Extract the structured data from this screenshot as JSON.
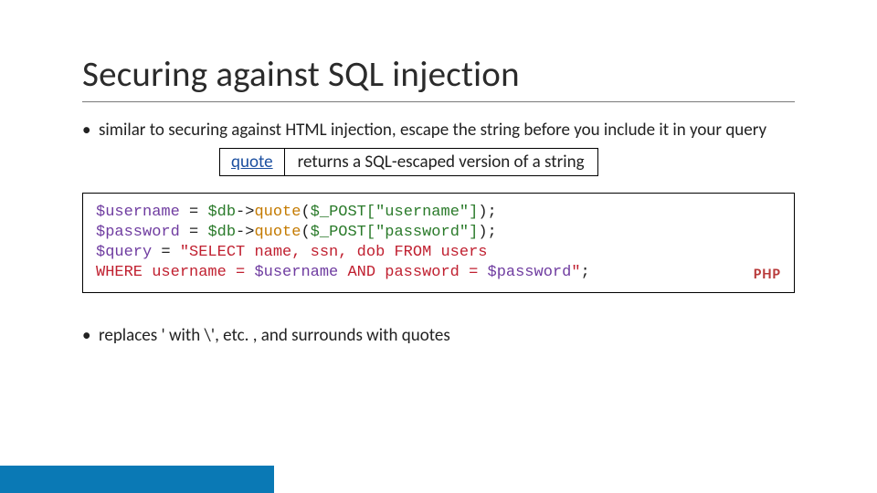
{
  "title": "Securing against SQL injection",
  "bullets": {
    "b1": "similar to securing against HTML injection, escape the string before you include it in your query"
  },
  "fn": {
    "name": "quote",
    "desc": "returns a SQL-escaped version of a string"
  },
  "code": {
    "var_user": "$username",
    "eq": " = ",
    "db": "$db",
    "arrow": "->",
    "quote": "quote",
    "lp": "(",
    "post": "$_POST",
    "br_user": "[\"username\"]",
    "rp_semi": ");",
    "var_pass": "$password",
    "br_pass": "[\"password\"]",
    "var_query": "$query",
    "str1": "\"SELECT name, ssn, dob FROM users",
    "str2a": "WHERE username = ",
    "str2b": " AND password = ",
    "str2c": "\"",
    "semi": ";"
  },
  "lang": "PHP",
  "bullet2": "replaces ' with \\', etc. , and surrounds with quotes"
}
